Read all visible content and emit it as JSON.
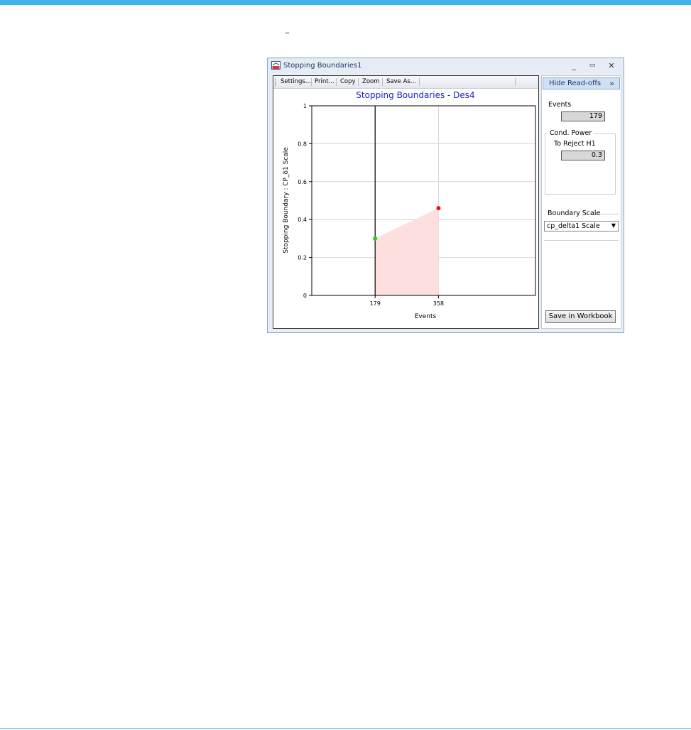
{
  "window": {
    "title": "Stopping Boundaries1",
    "minimize_glyph": "_",
    "maximize_glyph": "▭",
    "close_glyph": "✕"
  },
  "toolbar": {
    "settings_label": "Settings...",
    "print_label": "Print...",
    "copy_label": "Copy",
    "zoom_label": "Zoom",
    "save_as_label": "Save As..."
  },
  "readoffs": {
    "hide_label": "Hide Read-offs",
    "hide_chevron": "»",
    "events_label": "Events",
    "events_value": "179",
    "cond_power_title": "Cond. Power",
    "reject_label": "To Reject H1",
    "reject_value": "0.3",
    "boundary_scale_title": "Boundary Scale",
    "boundary_scale_value": "cp_delta1 Scale",
    "save_label": "Save in Workbook"
  },
  "colors": {
    "accent": "#40b4e8",
    "title_blue": "#1a1ad6",
    "region_fill": "#fde0de",
    "first_point": "#22cc22",
    "last_point": "#ee1111"
  },
  "chart_data": {
    "type": "area",
    "title": "Stopping Boundaries - Des4",
    "xlabel": "Events",
    "ylabel": "Stopping Boundary : CP_δ1 Scale",
    "x": [
      179,
      358
    ],
    "y": [
      0.3,
      0.46
    ],
    "xticks": [
      "179",
      "358"
    ],
    "yticks": [
      "0",
      "0.2",
      "0.4",
      "0.6",
      "0.8",
      "1"
    ],
    "ylim": [
      0,
      1
    ],
    "xlim": [
      0,
      632
    ],
    "marked_x": 179,
    "grid": true
  }
}
